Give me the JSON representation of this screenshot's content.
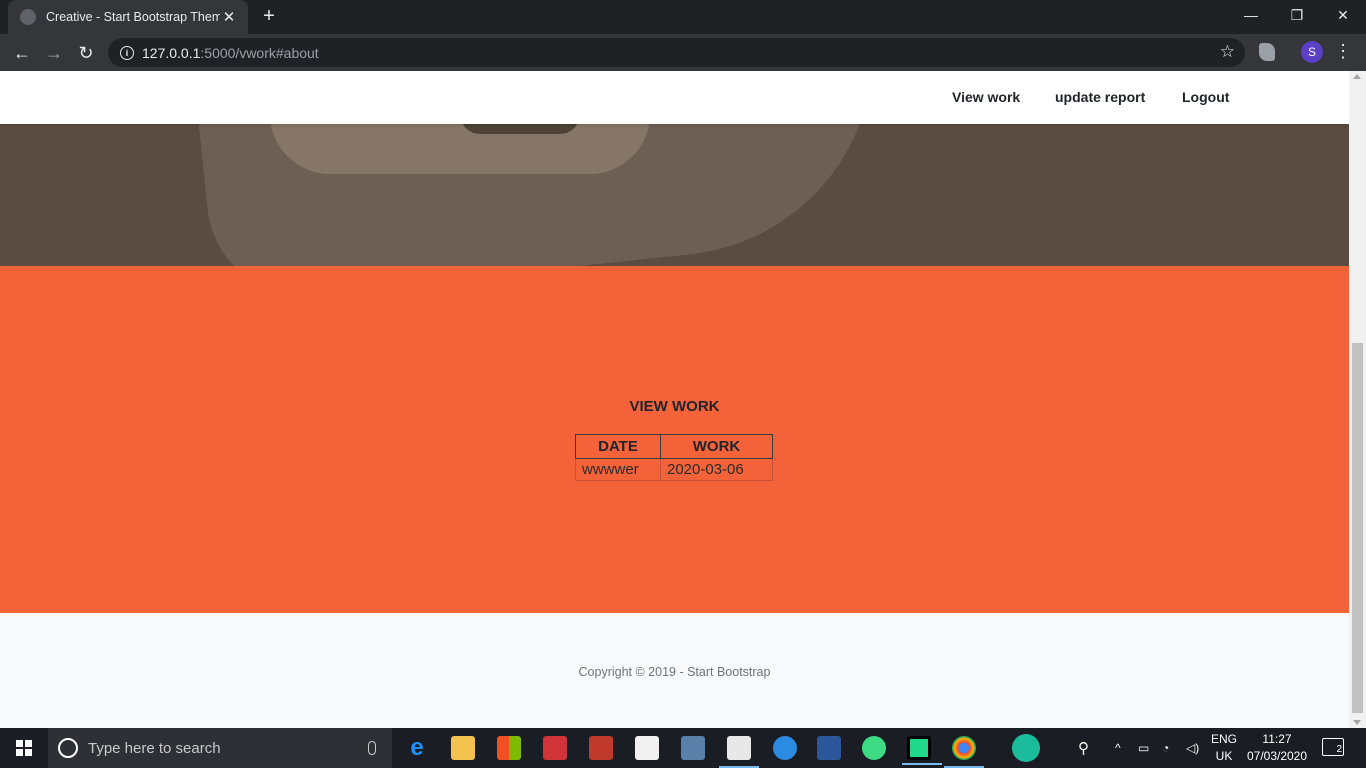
{
  "browser": {
    "tab_title": "Creative - Start Bootstrap Theme",
    "url_host": "127.0.0.1",
    "url_path": ":5000/vwork#about",
    "profile_initial": "S"
  },
  "navbar": {
    "links": [
      "View work",
      "update report",
      "Logout"
    ]
  },
  "about": {
    "title": "VIEW WORK",
    "table": {
      "headers": [
        "DATE",
        "WORK"
      ],
      "rows": [
        [
          "wwwwer",
          "2020-03-06"
        ]
      ]
    },
    "bg_color": "#f4623a"
  },
  "footer": {
    "text": "Copyright © 2019 - Start Bootstrap"
  },
  "taskbar": {
    "search_placeholder": "Type here to search",
    "language": "ENG",
    "region": "UK",
    "time": "11:27",
    "date": "07/03/2020",
    "notification_count": "2"
  }
}
